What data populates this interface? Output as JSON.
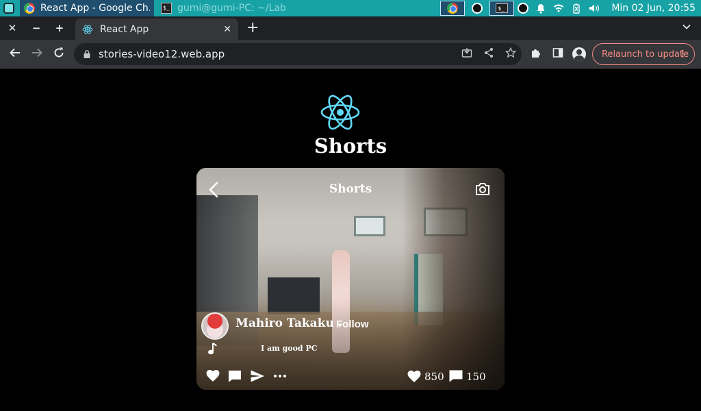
{
  "taskbar": {
    "active_task": "React App - Google Ch...",
    "inactive_task": "gumi@gumi-PC: ~/Lab...",
    "clock": "Min 02 Jun, 20:55"
  },
  "browser": {
    "tab_title": "React App",
    "url": "stories-video12.web.app",
    "relaunch_label": "Relaunch to update"
  },
  "page": {
    "heading": "Shorts",
    "card": {
      "title": "Shorts",
      "username": "Mahiro Takaku .",
      "follow_label": "Follow",
      "caption": "I am good PC",
      "likes": "850",
      "comments": "150"
    }
  },
  "colors": {
    "taskbar": "#17a2a6",
    "react_logo": "#61dafb",
    "relaunch": "#f28b82"
  }
}
